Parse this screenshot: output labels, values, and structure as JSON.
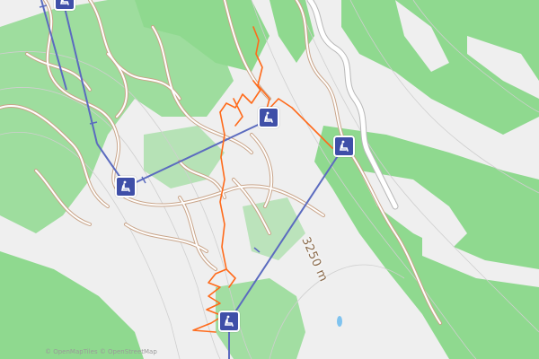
{
  "map": {
    "contour_label": "3250 m",
    "attribution": "© OpenMapTiles © OpenStreetMap",
    "colors": {
      "forest": "#8fd98f",
      "terrain": "#efefef",
      "road": "#ffffff",
      "road_casing": "#c9a58a",
      "piste": "#ff6a1a",
      "lift": "#5b6bbf",
      "lift_station": "#3f4fa8"
    },
    "lift_stations": [
      {
        "name": "chairlift-top-left-icon",
        "icon": "chairlift-icon"
      },
      {
        "name": "chairlift-left-icon",
        "icon": "chairlift-icon"
      },
      {
        "name": "chairlift-center-icon",
        "icon": "chairlift-icon"
      },
      {
        "name": "chairlift-right-icon",
        "icon": "chairlift-icon"
      },
      {
        "name": "chairlift-bottom-icon",
        "icon": "chairlift-icon"
      }
    ]
  }
}
